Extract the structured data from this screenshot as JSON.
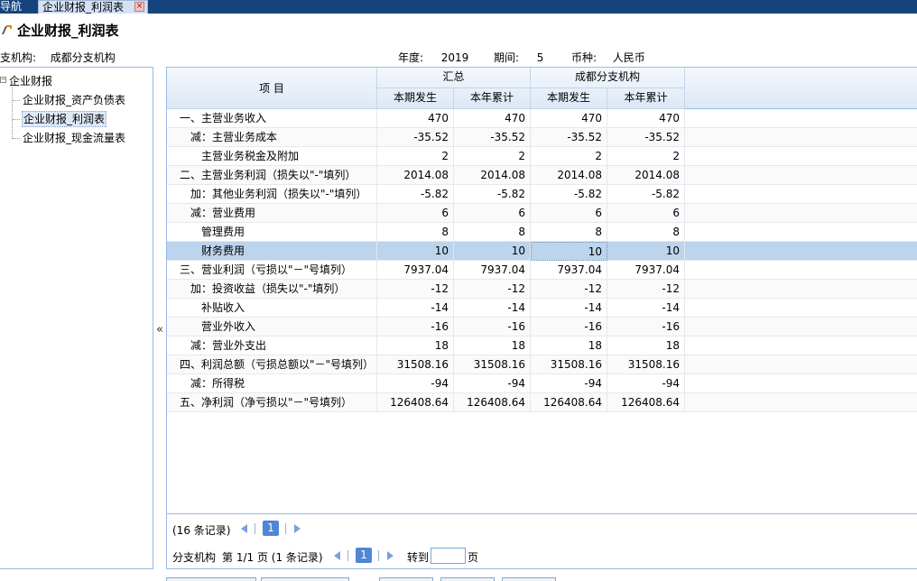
{
  "tabs": [
    {
      "label": "导航"
    },
    {
      "label": "企业财报_利润表"
    }
  ],
  "page": {
    "title": "企业财报_利润表"
  },
  "filters": {
    "branch_label": "分支机构:",
    "branch_value": "成都分支机构",
    "year_label": "年度:",
    "year_value": "2019",
    "period_label": "期间:",
    "period_value": "5",
    "currency_label": "币种:",
    "currency_value": "人民币"
  },
  "tree": {
    "root": "企业财报",
    "items": [
      "企业财报_资产负债表",
      "企业财报_利润表",
      "企业财报_现金流量表"
    ],
    "selected_index": 1
  },
  "grid": {
    "item_header": "项 目",
    "groups": [
      {
        "label": "汇总"
      },
      {
        "label": "成都分支机构"
      }
    ],
    "subheaders": [
      "本期发生",
      "本年累计",
      "本期发生",
      "本年累计"
    ],
    "rows": [
      {
        "label": "一、主营业务收入",
        "indent": 0,
        "values": [
          "470",
          "470",
          "470",
          "470"
        ]
      },
      {
        "label": "减：主营业务成本",
        "indent": 1,
        "values": [
          "-35.52",
          "-35.52",
          "-35.52",
          "-35.52"
        ]
      },
      {
        "label": "主营业务税金及附加",
        "indent": 2,
        "values": [
          "2",
          "2",
          "2",
          "2"
        ]
      },
      {
        "label": "二、主营业务利润（损失以\"-\"填列）",
        "indent": 0,
        "values": [
          "2014.08",
          "2014.08",
          "2014.08",
          "2014.08"
        ]
      },
      {
        "label": "加：其他业务利润（损失以\"-\"填列）",
        "indent": 1,
        "values": [
          "-5.82",
          "-5.82",
          "-5.82",
          "-5.82"
        ]
      },
      {
        "label": "减：营业费用",
        "indent": 1,
        "values": [
          "6",
          "6",
          "6",
          "6"
        ]
      },
      {
        "label": "管理费用",
        "indent": 2,
        "values": [
          "8",
          "8",
          "8",
          "8"
        ]
      },
      {
        "label": "财务费用",
        "indent": 2,
        "values": [
          "10",
          "10",
          "10",
          "10"
        ]
      },
      {
        "label": "三、营业利润（亏损以\"－\"号填列）",
        "indent": 0,
        "values": [
          "7937.04",
          "7937.04",
          "7937.04",
          "7937.04"
        ]
      },
      {
        "label": "加：投资收益（损失以\"-\"填列）",
        "indent": 1,
        "values": [
          "-12",
          "-12",
          "-12",
          "-12"
        ]
      },
      {
        "label": "补贴收入",
        "indent": 2,
        "values": [
          "-14",
          "-14",
          "-14",
          "-14"
        ]
      },
      {
        "label": "营业外收入",
        "indent": 2,
        "values": [
          "-16",
          "-16",
          "-16",
          "-16"
        ]
      },
      {
        "label": "减：营业外支出",
        "indent": 1,
        "values": [
          "18",
          "18",
          "18",
          "18"
        ]
      },
      {
        "label": "四、利润总额（亏损总额以\"－\"号填列）",
        "indent": 0,
        "values": [
          "31508.16",
          "31508.16",
          "31508.16",
          "31508.16"
        ]
      },
      {
        "label": "减：所得税",
        "indent": 1,
        "values": [
          "-94",
          "-94",
          "-94",
          "-94"
        ]
      },
      {
        "label": "五、净利润（净亏损以\"－\"号填列）",
        "indent": 0,
        "values": [
          "126408.64",
          "126408.64",
          "126408.64",
          "126408.64"
        ]
      }
    ],
    "selected_row": 7
  },
  "pager1": {
    "records": "(16 条记录)",
    "page": "1"
  },
  "pager2": {
    "label": "分支机构",
    "page_info": "第 1/1 页 (1 条记录)",
    "page": "1",
    "goto_label": "转到",
    "goto_suffix": "页"
  },
  "collapse_glyph": "«"
}
